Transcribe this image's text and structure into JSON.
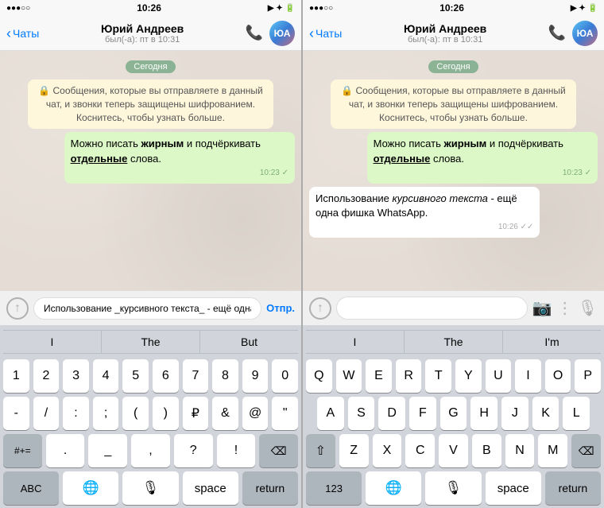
{
  "panel1": {
    "status": {
      "left": "●●●○○",
      "time": "10:26",
      "right": "▶ ✦ 🔋"
    },
    "header": {
      "back": "Чаты",
      "name": "Юрий Андреев",
      "sub": "был(-а): пт в 10:31"
    },
    "date_badge": "Сегодня",
    "system_msg": "🔒 Сообщения, которые вы отправляете в данный чат, и звонки теперь защищены шифрованием. Коснитесь, чтобы узнать больше.",
    "msg1_text": "Можно писать жирным и подчёркивать отдельные слова.",
    "msg1_time": "10:23 ✓",
    "input_text": "Использование _курсивного текста_ - ещё одна фишка WhatsApp.",
    "send_label": "Отпр.",
    "autocomplete": [
      "I",
      "The",
      "But"
    ],
    "keyboard_rows": {
      "nums": [
        "1",
        "2",
        "3",
        "4",
        "5",
        "6",
        "7",
        "8",
        "9",
        "0"
      ],
      "row2": [
        "-",
        "/",
        ":",
        ";",
        "(",
        ")",
        "₽",
        "&",
        "@",
        "\""
      ],
      "row3_left": [
        "#+="
      ],
      "row3_mid": [
        ".",
        "_",
        ",",
        "?",
        "!"
      ],
      "row3_right": [
        "⌫"
      ],
      "row4": [
        "ABC",
        "🌐",
        "🎤",
        "space",
        "return"
      ]
    }
  },
  "panel2": {
    "status": {
      "left": "●●●○○",
      "time": "10:26",
      "right": "▶ ✦ 🔋"
    },
    "header": {
      "back": "Чаты",
      "name": "Юрий Андреев",
      "sub": "был(-а): пт в 10:31"
    },
    "date_badge": "Сегодня",
    "system_msg": "🔒 Сообщения, которые вы отправляете в данный чат, и звонки теперь защищены шифрованием. Коснитесь, чтобы узнать больше.",
    "msg1_text": "Можно писать жирным и подчёркивать отдельные слова.",
    "msg1_time": "10:23 ✓",
    "msg2_time": "10:26 ✓✓",
    "autocomplete": [
      "I",
      "The",
      "I'm"
    ],
    "keyboard_rows": {
      "row1": [
        "Q",
        "W",
        "E",
        "R",
        "T",
        "Y",
        "U",
        "I",
        "O",
        "P"
      ],
      "row2": [
        "A",
        "S",
        "D",
        "F",
        "G",
        "H",
        "J",
        "K",
        "L"
      ],
      "row3": [
        "Z",
        "X",
        "C",
        "V",
        "B",
        "N",
        "M"
      ],
      "row4": [
        "123",
        "🌐",
        "🎤",
        "space",
        "return"
      ]
    }
  }
}
